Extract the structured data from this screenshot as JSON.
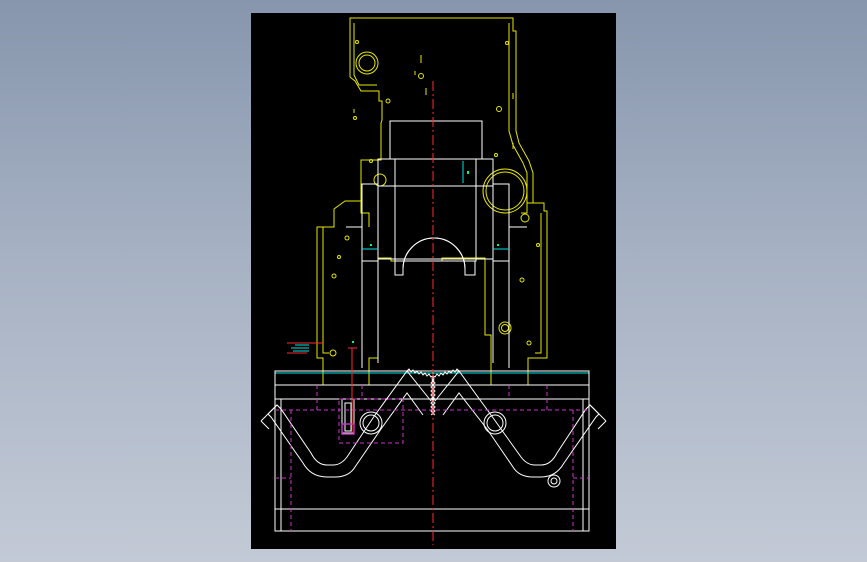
{
  "viewport": {
    "background": "#000000"
  },
  "layer_colors": {
    "outline": "#e6e600",
    "frame": "#ffffff",
    "center_line": "#ff2a2a",
    "hidden": "#cc33cc",
    "dimension": "#00e5e5",
    "marker": "#00ff66"
  },
  "drawing": {
    "view": "front view",
    "entities": [
      "upper-housing",
      "bore-circles",
      "center-line",
      "slide-block",
      "arch-cutout",
      "base-plate",
      "v-groove-cam",
      "gear-teeth",
      "pin-circles",
      "hidden-lines",
      "dimension-ticks"
    ]
  }
}
